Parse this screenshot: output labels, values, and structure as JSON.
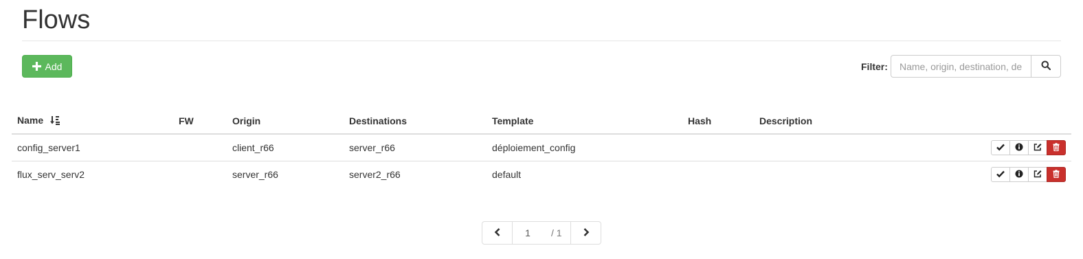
{
  "page": {
    "title": "Flows"
  },
  "toolbar": {
    "add_label": "Add",
    "add_icon": "plus-icon"
  },
  "filter": {
    "label": "Filter:",
    "placeholder": "Name, origin, destination, de",
    "value": "",
    "button_icon": "search-icon"
  },
  "table": {
    "columns": [
      "Name",
      "FW",
      "Origin",
      "Destinations",
      "Template",
      "Hash",
      "Description"
    ],
    "sort_icon": "sort-alpha-icon",
    "rows": [
      {
        "name": "config_server1",
        "fw": "",
        "origin": "client_r66",
        "destinations": "server_r66",
        "template": "déploiement_config",
        "hash": "",
        "description": ""
      },
      {
        "name": "flux_serv_serv2",
        "fw": "",
        "origin": "server_r66",
        "destinations": "server2_r66",
        "template": "default",
        "hash": "",
        "description": ""
      }
    ],
    "row_actions": [
      "check-icon",
      "info-icon",
      "edit-icon",
      "trash-icon"
    ]
  },
  "pagination": {
    "current": "1",
    "total": "/ 1"
  },
  "colors": {
    "success": "#5cb85c",
    "danger": "#c9302c",
    "text": "#333333",
    "border": "#dddddd"
  }
}
